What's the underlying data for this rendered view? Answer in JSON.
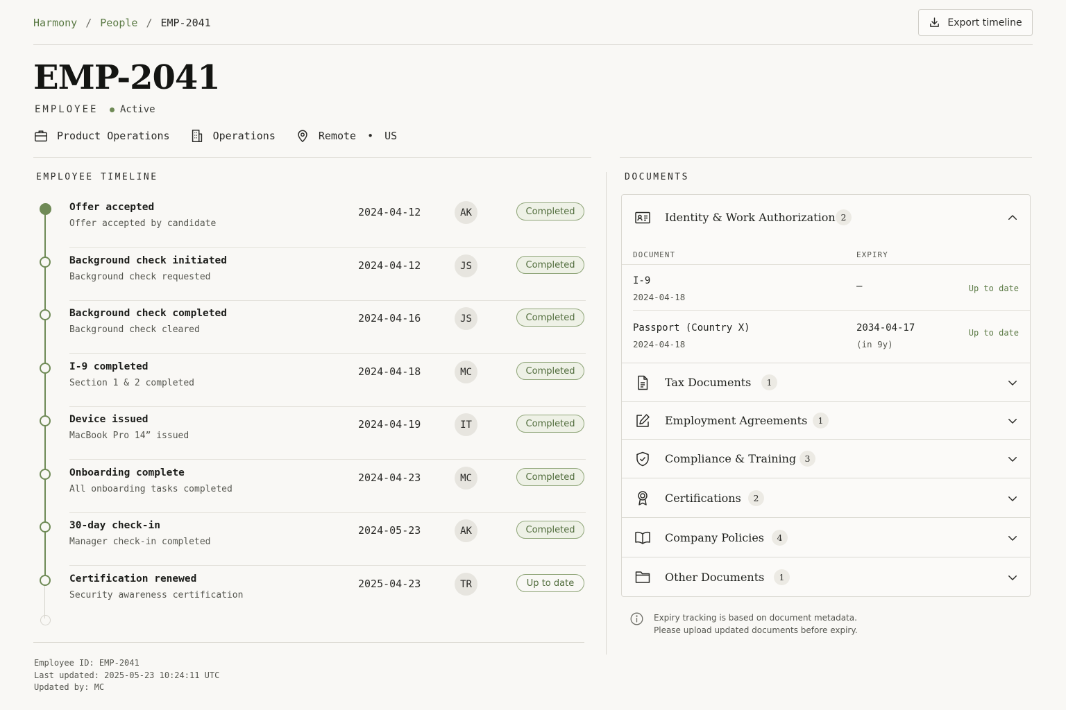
{
  "breadcrumb": {
    "root": "Harmony",
    "section": "People",
    "current": "EMP-2041",
    "separator": "/"
  },
  "header": {
    "export_label": "Export timeline",
    "title": "EMP-2041",
    "kind": "EMPLOYEE",
    "status": "Active",
    "department": "Product Operations",
    "division": "Operations",
    "location": "Remote",
    "location_sep": "•",
    "country": "US"
  },
  "timeline": {
    "title": "EMPLOYEE TIMELINE",
    "events": [
      {
        "name": "Offer accepted",
        "desc": "Offer accepted by candidate",
        "date": "2024-04-12",
        "actor": "AK",
        "status": "Completed"
      },
      {
        "name": "Background check initiated",
        "desc": "Background check requested",
        "date": "2024-04-12",
        "actor": "JS",
        "status": "Completed"
      },
      {
        "name": "Background check completed",
        "desc": "Background check cleared",
        "date": "2024-04-16",
        "actor": "JS",
        "status": "Completed"
      },
      {
        "name": "I-9 completed",
        "desc": "Section 1 & 2 completed",
        "date": "2024-04-18",
        "actor": "MC",
        "status": "Completed"
      },
      {
        "name": "Device issued",
        "desc": "MacBook Pro 14” issued",
        "date": "2024-04-19",
        "actor": "IT",
        "status": "Completed"
      },
      {
        "name": "Onboarding complete",
        "desc": "All onboarding tasks completed",
        "date": "2024-04-23",
        "actor": "MC",
        "status": "Completed"
      },
      {
        "name": "30-day check-in",
        "desc": "Manager check-in completed",
        "date": "2024-05-23",
        "actor": "AK",
        "status": "Completed"
      },
      {
        "name": "Certification renewed",
        "desc": "Security awareness certification",
        "date": "2025-04-23",
        "actor": "TR",
        "status": "Up to date"
      }
    ]
  },
  "footer": {
    "employee_id": "Employee ID: EMP-2041",
    "last_updated": "Last updated: 2025-05-23 10:24:11 UTC",
    "updated_by": "Updated by: MC"
  },
  "documents": {
    "title": "DOCUMENTS",
    "columns": {
      "document": "DOCUMENT",
      "expiry": "EXPIRY"
    },
    "groups": [
      {
        "name": "Identity & Work Authorization",
        "count": "2",
        "icon": "id-card-icon",
        "expanded": true
      },
      {
        "name": "Tax Documents",
        "count": "1",
        "icon": "file-icon"
      },
      {
        "name": "Employment Agreements",
        "count": "1",
        "icon": "pen-square-icon"
      },
      {
        "name": "Compliance & Training",
        "count": "3",
        "icon": "shield-check-icon"
      },
      {
        "name": "Certifications",
        "count": "2",
        "icon": "award-icon"
      },
      {
        "name": "Company Policies",
        "count": "4",
        "icon": "book-icon"
      },
      {
        "name": "Other Documents",
        "count": "1",
        "icon": "folder-icon"
      }
    ],
    "items": [
      {
        "name": "I-9",
        "date": "2024-04-18",
        "expiry": "—",
        "expiry_note": "",
        "status": "Up to date"
      },
      {
        "name": "Passport (Country X)",
        "date": "2024-04-18",
        "expiry": "2034-04-17",
        "expiry_note": "(in 9y)",
        "status": "Up to date"
      }
    ],
    "note_line1": "Expiry tracking is based on document metadata.",
    "note_line2": "Please upload updated documents before expiry."
  },
  "colors": {
    "accent": "#6f8a56",
    "link": "#5b7a45",
    "badge_bg": "#eef1e6",
    "background": "#f9f8f5"
  }
}
